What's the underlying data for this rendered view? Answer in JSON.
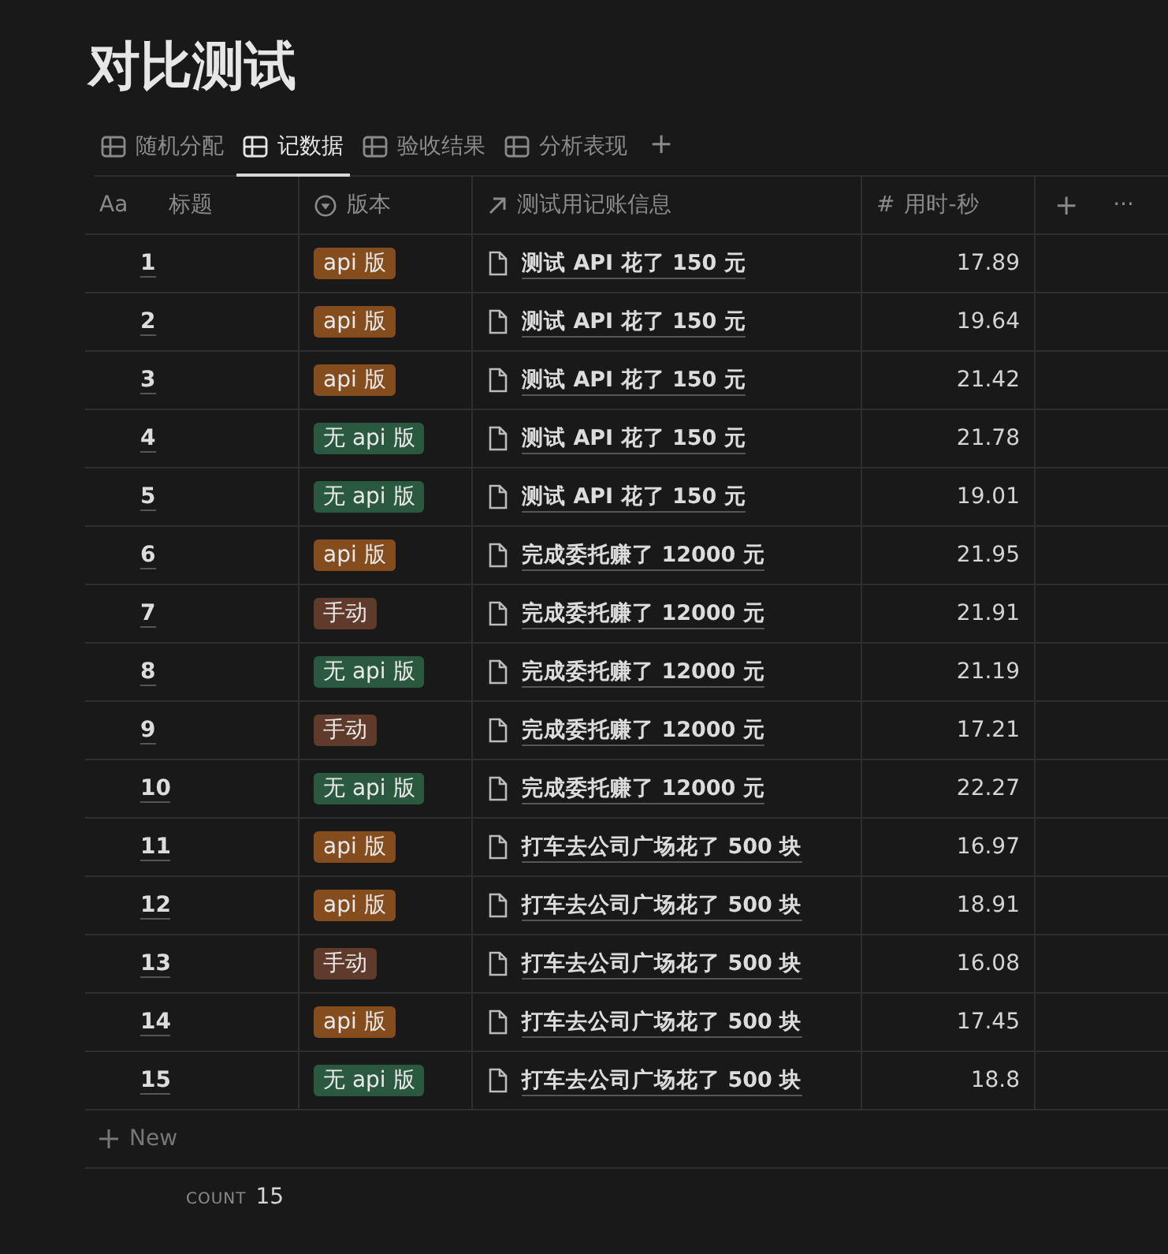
{
  "page_title": "对比测试",
  "tabs": [
    {
      "label": "随机分配",
      "selected": false
    },
    {
      "label": "记数据",
      "selected": true
    },
    {
      "label": "验收结果",
      "selected": false
    },
    {
      "label": "分析表现",
      "selected": false
    }
  ],
  "add_tab": "+",
  "table": {
    "columns": [
      {
        "label": "标题",
        "icon": "Aa",
        "kind": "title"
      },
      {
        "label": "版本",
        "kind": "select"
      },
      {
        "label": "测试用记账信息",
        "kind": "relation"
      },
      {
        "label": "用时-秒",
        "icon": "#",
        "kind": "number"
      }
    ],
    "add_column": "+",
    "more": "···",
    "rows": [
      {
        "title": "1",
        "version": {
          "label": "api 版",
          "color": "#854c1d"
        },
        "info": "测试 API 花了 150 元",
        "time": "17.89"
      },
      {
        "title": "2",
        "version": {
          "label": "api 版",
          "color": "#854c1d"
        },
        "info": "测试 API 花了 150 元",
        "time": "19.64"
      },
      {
        "title": "3",
        "version": {
          "label": "api 版",
          "color": "#854c1d"
        },
        "info": "测试 API 花了 150 元",
        "time": "21.42"
      },
      {
        "title": "4",
        "version": {
          "label": "无 api 版",
          "color": "#2b593f"
        },
        "info": "测试 API 花了 150 元",
        "time": "21.78"
      },
      {
        "title": "5",
        "version": {
          "label": "无 api 版",
          "color": "#2b593f"
        },
        "info": "测试 API 花了 150 元",
        "time": "19.01"
      },
      {
        "title": "6",
        "version": {
          "label": "api 版",
          "color": "#854c1d"
        },
        "info": "完成委托赚了 12000 元",
        "time": "21.95"
      },
      {
        "title": "7",
        "version": {
          "label": "手动",
          "color": "#603b2c"
        },
        "info": "完成委托赚了 12000 元",
        "time": "21.91"
      },
      {
        "title": "8",
        "version": {
          "label": "无 api 版",
          "color": "#2b593f"
        },
        "info": "完成委托赚了 12000 元",
        "time": "21.19"
      },
      {
        "title": "9",
        "version": {
          "label": "手动",
          "color": "#603b2c"
        },
        "info": "完成委托赚了 12000 元",
        "time": "17.21"
      },
      {
        "title": "10",
        "version": {
          "label": "无 api 版",
          "color": "#2b593f"
        },
        "info": "完成委托赚了 12000 元",
        "time": "22.27"
      },
      {
        "title": "11",
        "version": {
          "label": "api 版",
          "color": "#854c1d"
        },
        "info": "打车去公司广场花了 500 块",
        "time": "16.97"
      },
      {
        "title": "12",
        "version": {
          "label": "api 版",
          "color": "#854c1d"
        },
        "info": "打车去公司广场花了 500 块",
        "time": "18.91"
      },
      {
        "title": "13",
        "version": {
          "label": "手动",
          "color": "#603b2c"
        },
        "info": "打车去公司广场花了 500 块",
        "time": "16.08"
      },
      {
        "title": "14",
        "version": {
          "label": "api 版",
          "color": "#854c1d"
        },
        "info": "打车去公司广场花了 500 块",
        "time": "17.45"
      },
      {
        "title": "15",
        "version": {
          "label": "无 api 版",
          "color": "#2b593f"
        },
        "info": "打车去公司广场花了 500 块",
        "time": "18.8"
      }
    ],
    "new_row": "New",
    "footer": {
      "label": "COUNT",
      "value": "15"
    }
  }
}
